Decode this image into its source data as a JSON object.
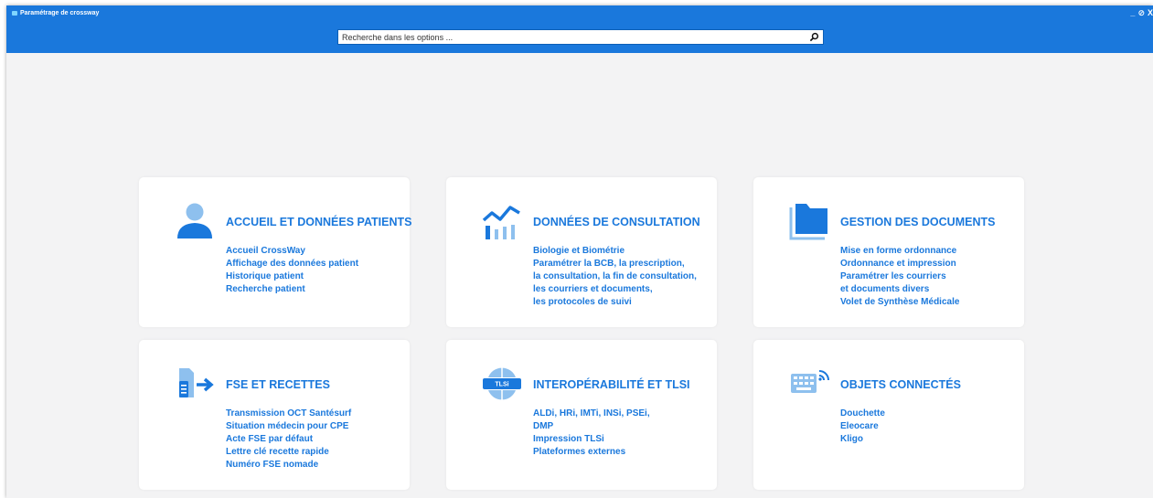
{
  "window": {
    "title": "Paramétrage de crossway",
    "controls": [
      "_",
      "⊘",
      "X"
    ]
  },
  "search": {
    "placeholder": "Recherche dans les options ..."
  },
  "colors": {
    "accent": "#1a78dc",
    "background": "#f3f3f4",
    "card": "#ffffff"
  },
  "cards": [
    {
      "icon": "user-icon",
      "title": "ACCUEIL ET DONNÉES PATIENTS",
      "items": [
        "Accueil CrossWay",
        "Affichage des données patient",
        "Historique patient",
        "Recherche patient"
      ]
    },
    {
      "icon": "chart-icon",
      "title": "DONNÉES DE CONSULTATION",
      "items": [
        "Biologie et Biométrie",
        "Paramétrer la BCB,  la prescription,",
        "la consultation, la fin de consultation,",
        "les courriers et documents,",
        "les protocoles de suivi"
      ]
    },
    {
      "icon": "folder-icon",
      "title": "GESTION DES DOCUMENTS",
      "items": [
        "Mise en forme ordonnance",
        "Ordonnance et impression",
        "Paramétrer les courriers",
        "et documents divers",
        "Volet de Synthèse Médicale"
      ]
    },
    {
      "icon": "fse-transfer-icon",
      "title": "FSE ET RECETTES",
      "items": [
        "Transmission OCT Santésurf",
        "Situation médecin pour CPE",
        "Acte FSE par défaut",
        "Lettre clé recette rapide",
        "Numéro FSE nomade"
      ]
    },
    {
      "icon": "tlsi-globe-icon",
      "title": "INTEROPÉRABILITÉ ET TLSI",
      "icon_text": "TLSi",
      "items": [
        "ALDi, HRi, IMTi, INSi, PSEi,",
        "DMP",
        "Impression TLSi",
        "Plateformes externes"
      ]
    },
    {
      "icon": "connected-keyboard-icon",
      "title": "OBJETS CONNECTÉS",
      "items": [
        "Douchette",
        "Eleocare",
        "Kligo"
      ]
    }
  ]
}
